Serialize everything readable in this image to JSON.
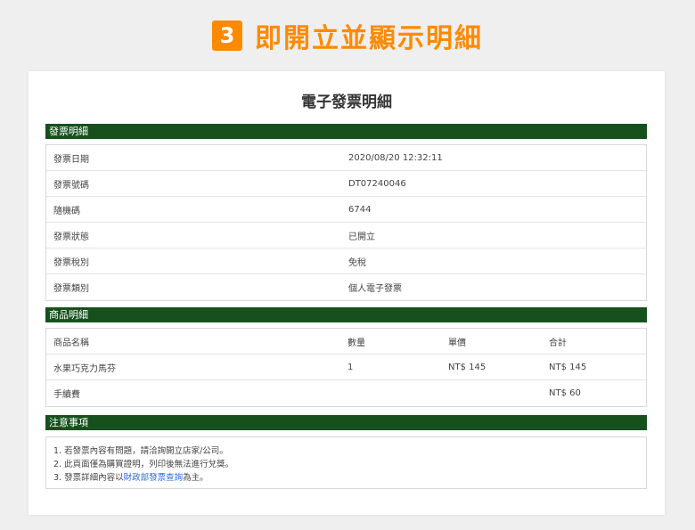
{
  "banner": {
    "step": "3",
    "title": "即開立並顯示明細"
  },
  "card_title": "電子發票明細",
  "invoice_section": {
    "header": "發票明細",
    "rows": [
      {
        "label": "發票日期",
        "value": "2020/08/20 12:32:11"
      },
      {
        "label": "發票號碼",
        "value": "DT07240046"
      },
      {
        "label": "隨機碼",
        "value": "6744"
      },
      {
        "label": "發票狀態",
        "value": "已開立"
      },
      {
        "label": "發票稅別",
        "value": "免稅"
      },
      {
        "label": "發票類別",
        "value": "個人電子發票"
      }
    ]
  },
  "product_section": {
    "header": "商品明細",
    "columns": [
      "商品名稱",
      "數量",
      "單價",
      "合計"
    ],
    "rows": [
      [
        "水果巧克力馬芬",
        "1",
        "NT$ 145",
        "NT$ 145"
      ],
      [
        "手續費",
        "",
        "",
        "NT$ 60"
      ]
    ]
  },
  "notes_section": {
    "header": "注意事項",
    "line1": "1. 若發票內容有問題，請洽詢開立店家/公司。",
    "line2": "2. 此頁面僅為購買證明，列印後無法進行兌獎。",
    "line3_prefix": "3. 發票詳細內容以",
    "line3_link": "財政部發票查詢",
    "line3_suffix": "為主。"
  },
  "colors": {
    "accent": "#ff8a00",
    "section_header_bg": "#16501d",
    "link": "#2a6bd6"
  }
}
